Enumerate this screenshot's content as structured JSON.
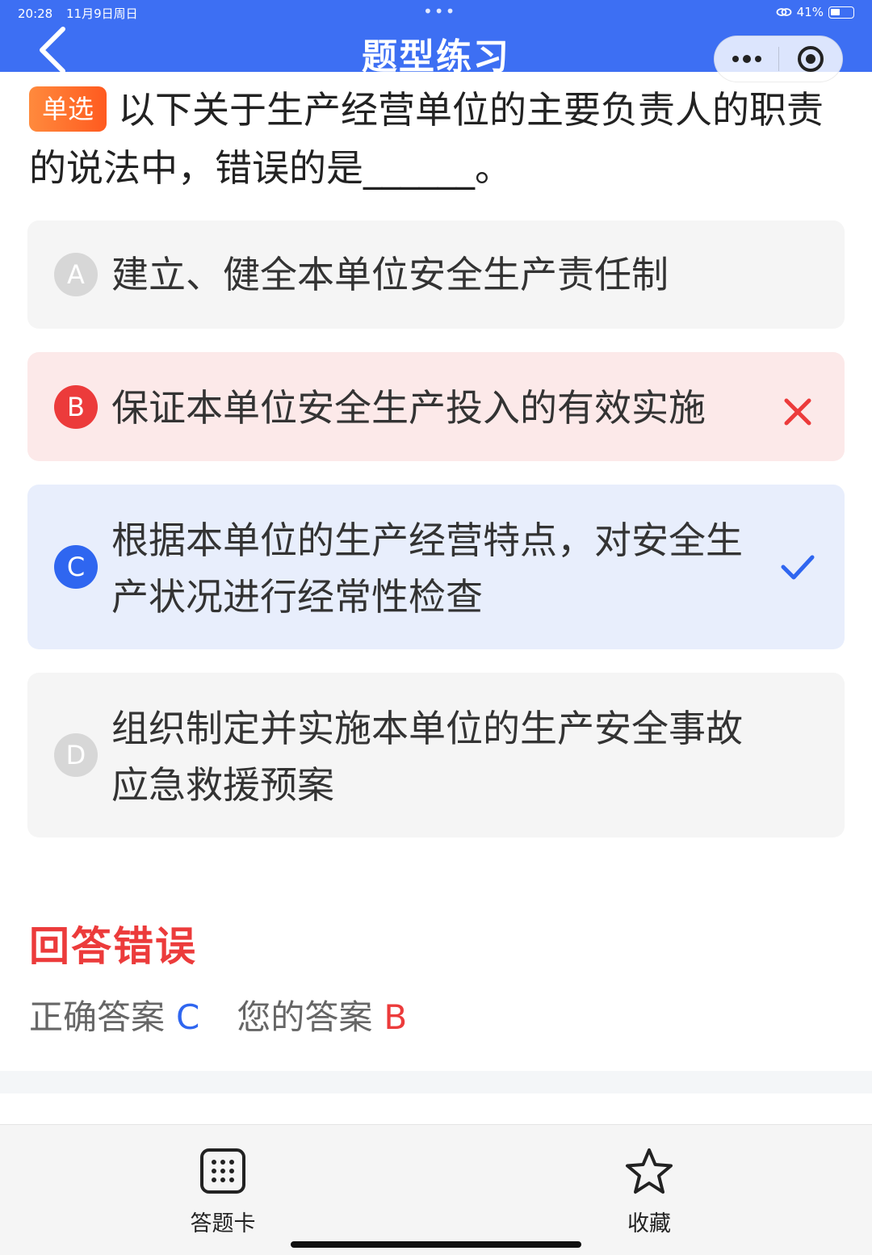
{
  "status_bar": {
    "time": "20:28",
    "date": "11月9日周日",
    "battery": "41%",
    "battery_level": 0.41
  },
  "header": {
    "title": "题型练习"
  },
  "question": {
    "type_badge": "单选",
    "text": "以下关于生产经营单位的主要负责人的职责的说法中，错误的是______。"
  },
  "options": [
    {
      "letter": "A",
      "text": "建立、健全本单位安全生产责任制",
      "state": "normal"
    },
    {
      "letter": "B",
      "text": "保证本单位安全生产投入的有效实施",
      "state": "wrong"
    },
    {
      "letter": "C",
      "text": "根据本单位的生产经营特点，对安全生产状况进行经常性检查",
      "state": "correct"
    },
    {
      "letter": "D",
      "text": "组织制定并实施本单位的生产安全事故应急救援预案",
      "state": "normal"
    }
  ],
  "result": {
    "title": "回答错误",
    "correct_label": "正确答案",
    "correct_value": "C",
    "yours_label": "您的答案",
    "yours_value": "B"
  },
  "bottom_bar": {
    "answer_card": "答题卡",
    "favorite": "收藏"
  },
  "colors": {
    "header": "#3d6ff3",
    "wrong": "#ec3b3b",
    "correct": "#2f66f0",
    "badge": "#ff6a2a"
  }
}
